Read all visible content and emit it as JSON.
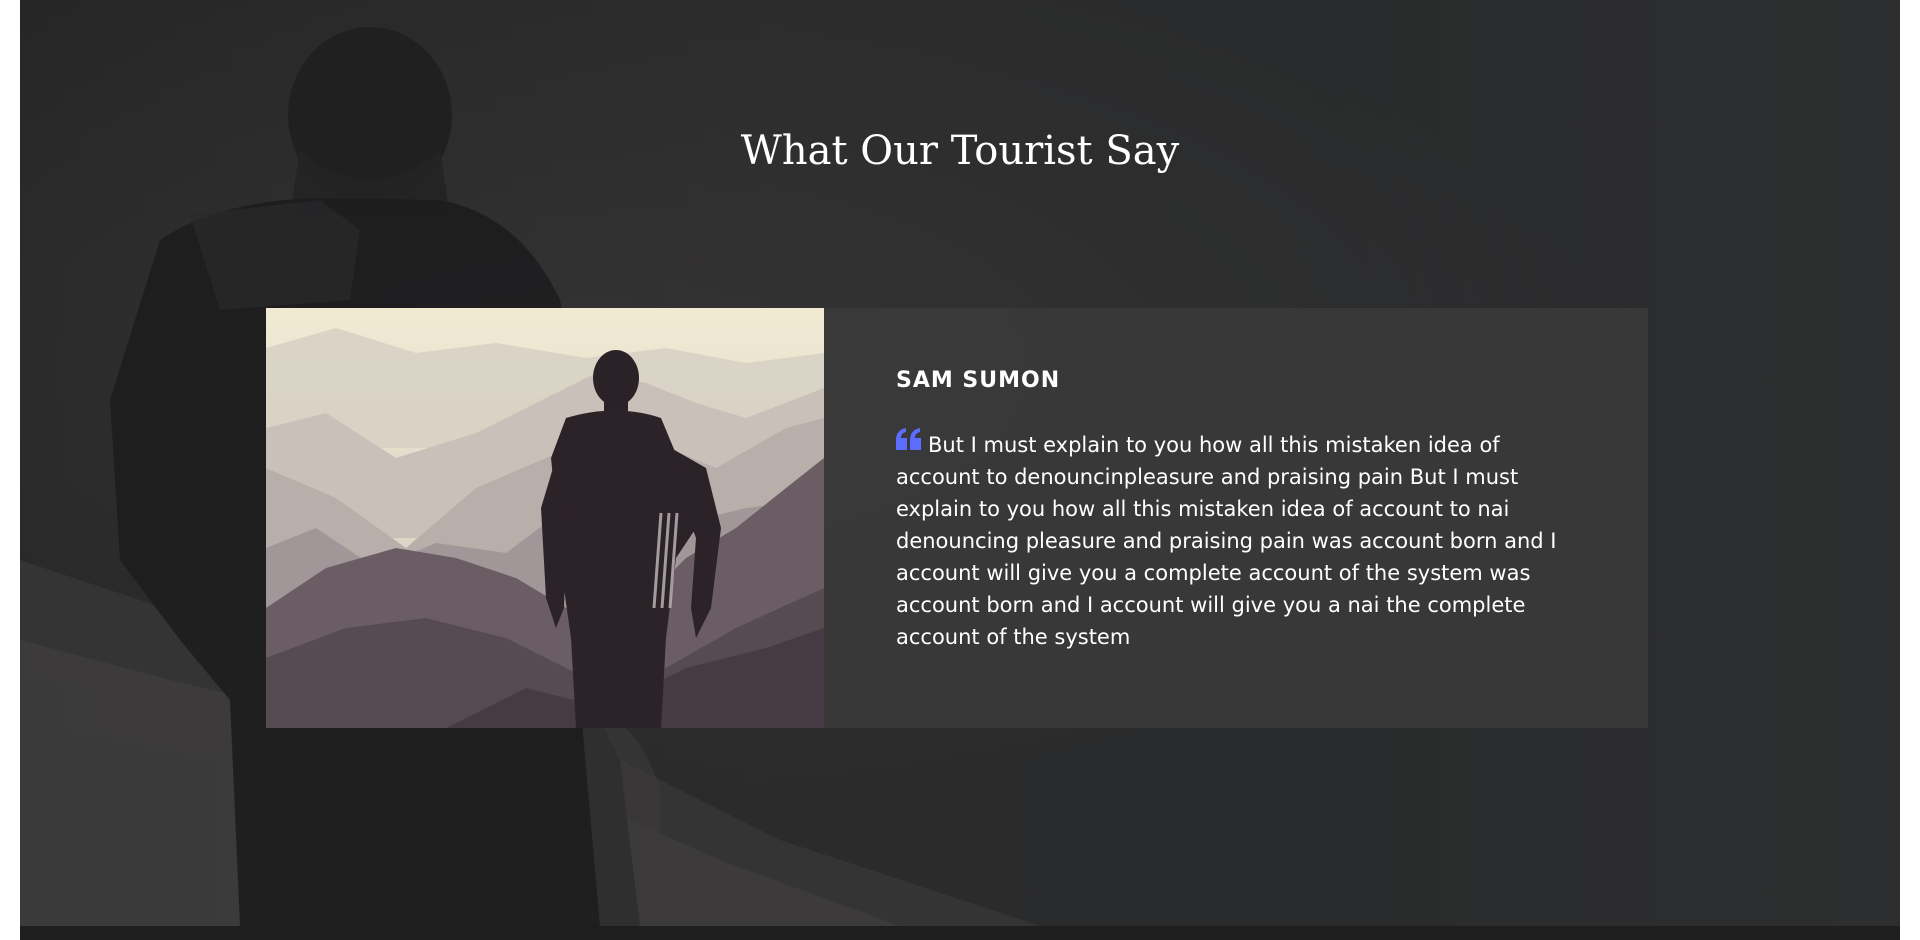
{
  "section": {
    "heading": "What Our Tourist Say"
  },
  "testimonial": {
    "name": "SAM SUMON",
    "quote": "But I must explain to you how all this mistaken idea of account to denouncinpleasure and praising pain But I must explain to you how all this mistaken idea of account to nai denouncing pleasure and praising pain was account born and I account will give you a complete account of the system was account born and I account will give you a nai the complete account of the system",
    "quote_icon": "quote-left-icon",
    "photo": "hiker-on-mountain-photo"
  },
  "colors": {
    "accent": "#5b6cff",
    "card_bg": "#3a3a3a",
    "section_bg": "#2a2a2b",
    "text": "#ffffff"
  }
}
